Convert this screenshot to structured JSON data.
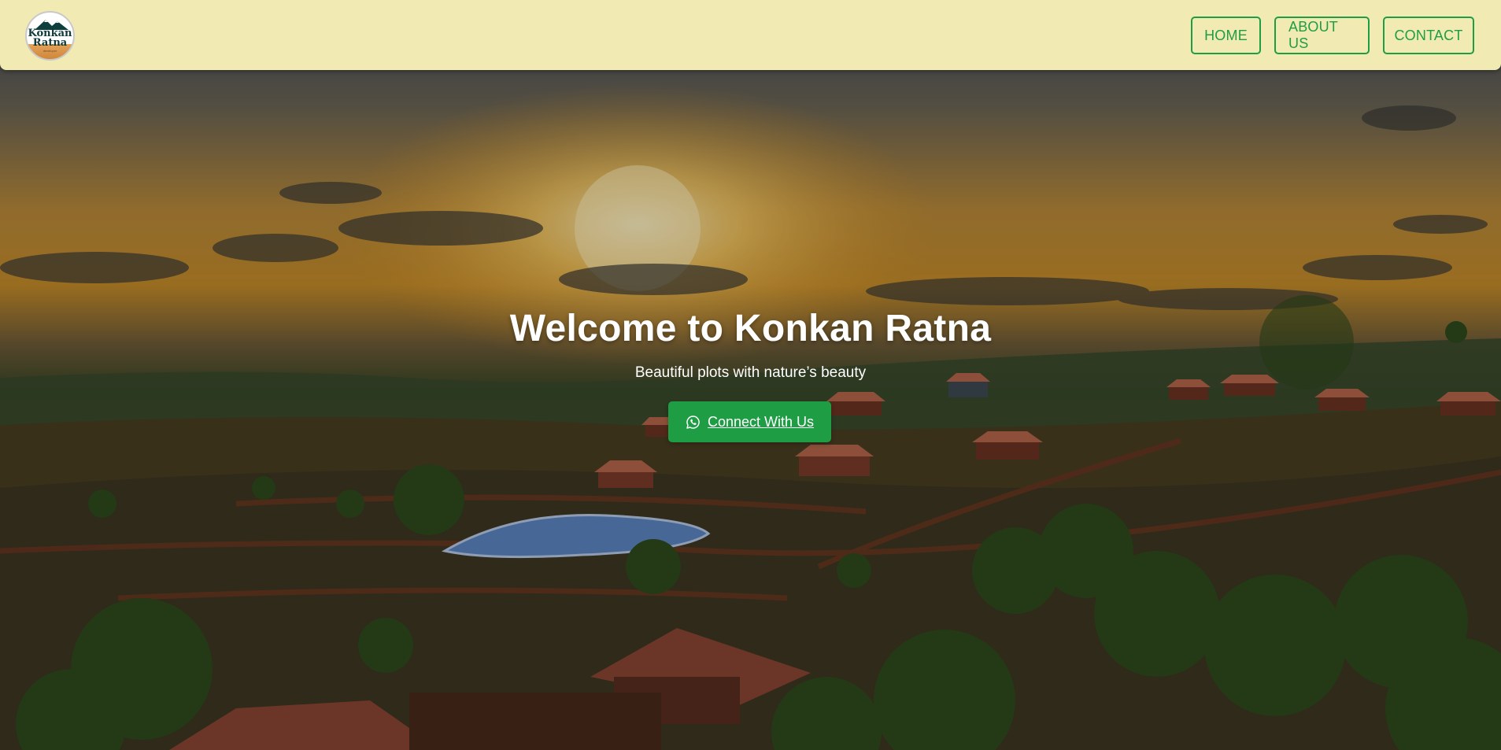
{
  "navbar": {
    "logo": {
      "line1": "Konkan",
      "line2": "Ratna",
      "tagline": "developer"
    },
    "links": [
      {
        "label": "HOME"
      },
      {
        "label": "ABOUT US"
      },
      {
        "label": "CONTACT"
      }
    ]
  },
  "hero": {
    "title": "Welcome to Konkan Ratna",
    "subtitle": "Beautiful plots with nature’s beauty",
    "cta_label": "Connect With Us",
    "cta_icon": "whatsapp-icon"
  },
  "colors": {
    "navbar_bg": "#f1eab3",
    "accent_green": "#1f9d45",
    "text_white": "#ffffff"
  }
}
